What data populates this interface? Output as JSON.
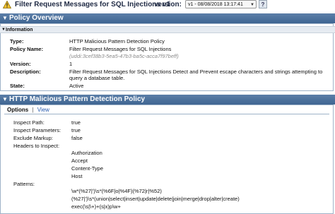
{
  "header": {
    "title": "Filter Request Messages for SQL Injections v1",
    "version_label": "version:",
    "version_selected": "v1 - 08/08/2018 13:17:41",
    "help_label": "?"
  },
  "policy_overview": {
    "title": "Policy Overview",
    "information_label": "Information",
    "rows": [
      {
        "label": "Type:",
        "value": "HTTP Malicious Pattern Detection Policy"
      },
      {
        "label": "Policy Name:",
        "value": "Filter Request Messages for SQL Injections"
      },
      {
        "label": "",
        "value": "(uddi:3cef38b3-5ea5-47b3-ba5c-acca7f97beff)"
      },
      {
        "label": "Version:",
        "value": "1"
      },
      {
        "label": "Description:",
        "value": "Filter Request Messages for SQL Injections Detect and Prevent escape characters and strings attempting to"
      },
      {
        "label": "",
        "value": "query a database table."
      },
      {
        "label": "State:",
        "value": "Active"
      }
    ]
  },
  "detection_policy": {
    "title": "HTTP Malicious Pattern Detection Policy",
    "tabs": {
      "options": "Options",
      "separator": "|",
      "view": "View"
    },
    "settings": [
      {
        "label": "Inspect Path:",
        "value": "true"
      },
      {
        "label": "Inspect Parameters:",
        "value": "true"
      },
      {
        "label": "Exclude Markup:",
        "value": "false"
      },
      {
        "label": "Headers to Inspect:",
        "value": ""
      }
    ],
    "headers": [
      "Authorization",
      "Accept",
      "Content-Type",
      "Host"
    ],
    "patterns_label": "Patterns:",
    "patterns": [
      "\\w*(%27|')\\s*(%6F|o|%4F)(%72|r|%52)",
      "(%27|')\\s*(union|select|insert|update|delete|join|merge|drop|alter|create)",
      "exec(\\s|\\+)+(s|x)p\\w+"
    ]
  }
}
